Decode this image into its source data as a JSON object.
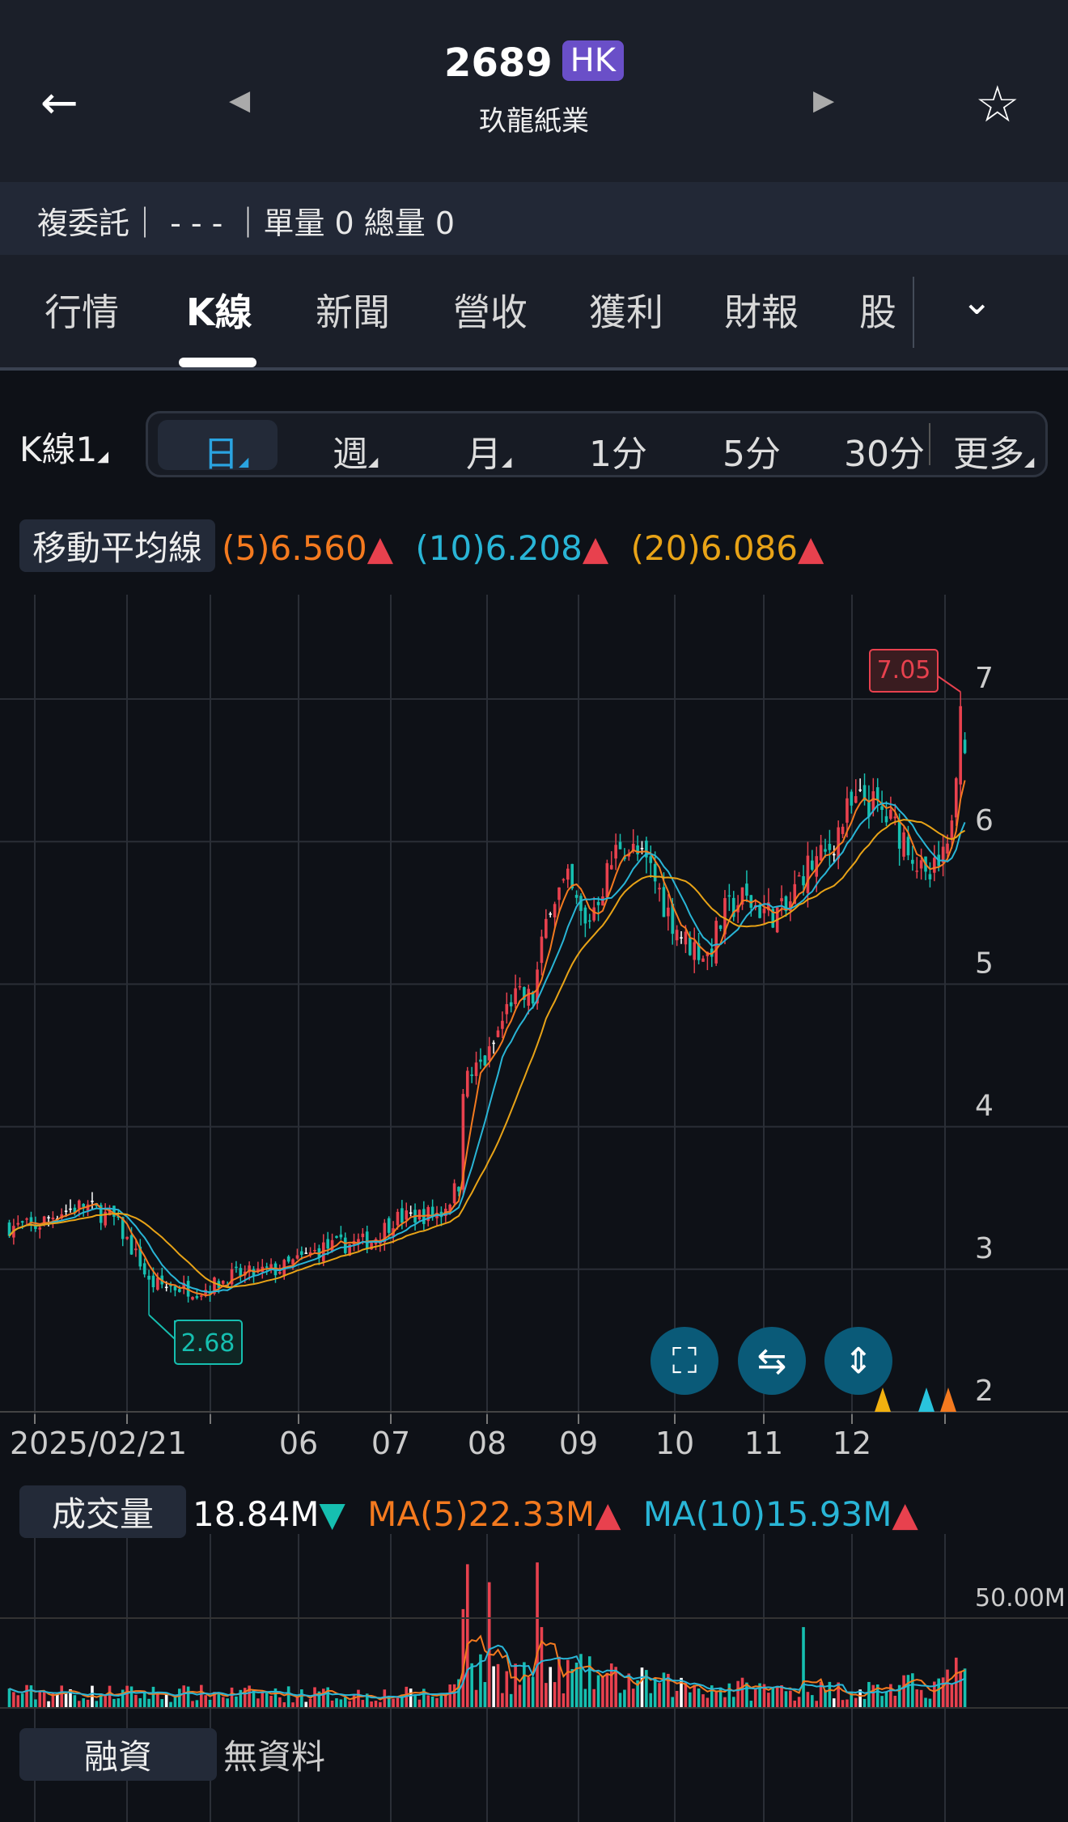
{
  "header": {
    "code": "2689",
    "market": "HK",
    "name": "玖龍紙業"
  },
  "info_bar": {
    "text": "複委託｜ - - - ｜單量 0 總量 0"
  },
  "tabs": [
    {
      "label": "行情"
    },
    {
      "label": "K線",
      "active": true
    },
    {
      "label": "新聞"
    },
    {
      "label": "營收"
    },
    {
      "label": "獲利"
    },
    {
      "label": "財報"
    },
    {
      "label": "股"
    }
  ],
  "kline": {
    "selector": "K線1",
    "periods": [
      {
        "label": "日",
        "active": true
      },
      {
        "label": "週"
      },
      {
        "label": "月"
      },
      {
        "label": "1分"
      },
      {
        "label": "5分"
      },
      {
        "label": "30分"
      },
      {
        "label": "更多"
      }
    ]
  },
  "ma_legend": {
    "label": "移動平均線",
    "ma5": "(5)6.560",
    "ma10": "(10)6.208",
    "ma20": "(20)6.086",
    "arrow": "▲"
  },
  "volume_legend": {
    "label": "成交量",
    "value": "18.84M",
    "value_arrow": "▼",
    "ma5": "MA(5)22.33M",
    "ma10": "MA(10)15.93M",
    "arrow": "▲"
  },
  "margin": {
    "label": "融資",
    "value": "無資料"
  },
  "colors": {
    "up": "#e8414e",
    "down": "#16bfb0",
    "ma5": "#f47a1f",
    "ma10": "#29b5d6",
    "ma20": "#e8a317",
    "bg": "#0e1117"
  },
  "chart_data": {
    "type": "candlestick",
    "y_ticks": [
      "7",
      "6",
      "5",
      "4",
      "3",
      "2"
    ],
    "ylim": [
      2,
      7
    ],
    "x_labels": [
      "2025/02/21",
      "06",
      "07",
      "08",
      "09",
      "10",
      "11",
      "12"
    ],
    "high_marker": "7.05",
    "low_marker": "2.68",
    "volume_tick": "50.00M",
    "days": 220,
    "price_anchors": [
      [
        0,
        3.3
      ],
      [
        6,
        3.3
      ],
      [
        11,
        3.4
      ],
      [
        17,
        3.45
      ],
      [
        24,
        3.35
      ],
      [
        30,
        3.05
      ],
      [
        32,
        2.9
      ],
      [
        44,
        2.85
      ],
      [
        51,
        2.95
      ],
      [
        62,
        3.0
      ],
      [
        72,
        3.15
      ],
      [
        83,
        3.2
      ],
      [
        88,
        3.35
      ],
      [
        99,
        3.4
      ],
      [
        103,
        3.6
      ],
      [
        104,
        4.3
      ],
      [
        110,
        4.5
      ],
      [
        115,
        4.9
      ],
      [
        120,
        4.9
      ],
      [
        124,
        5.6
      ],
      [
        128,
        5.7
      ],
      [
        132,
        5.4
      ],
      [
        136,
        5.7
      ],
      [
        140,
        6.0
      ],
      [
        144,
        5.9
      ],
      [
        147,
        5.8
      ],
      [
        151,
        5.5
      ],
      [
        155,
        5.3
      ],
      [
        160,
        5.2
      ],
      [
        164,
        5.5
      ],
      [
        168,
        5.6
      ],
      [
        174,
        5.5
      ],
      [
        178,
        5.5
      ],
      [
        182,
        5.8
      ],
      [
        187,
        5.9
      ],
      [
        192,
        6.2
      ],
      [
        196,
        6.3
      ],
      [
        200,
        6.2
      ],
      [
        206,
        6.0
      ],
      [
        210,
        5.7
      ],
      [
        215,
        5.9
      ],
      [
        218,
        6.9
      ],
      [
        219,
        6.7
      ]
    ],
    "volume_base_M": [
      [
        0,
        8
      ],
      [
        100,
        7
      ],
      [
        103,
        18
      ],
      [
        130,
        18
      ],
      [
        150,
        12
      ],
      [
        180,
        9
      ],
      [
        200,
        10
      ],
      [
        219,
        14
      ]
    ],
    "volume_spikes_M": [
      [
        104,
        55
      ],
      [
        105,
        80
      ],
      [
        110,
        70
      ],
      [
        121,
        81
      ],
      [
        122,
        45
      ],
      [
        182,
        45
      ],
      [
        217,
        28
      ]
    ]
  }
}
